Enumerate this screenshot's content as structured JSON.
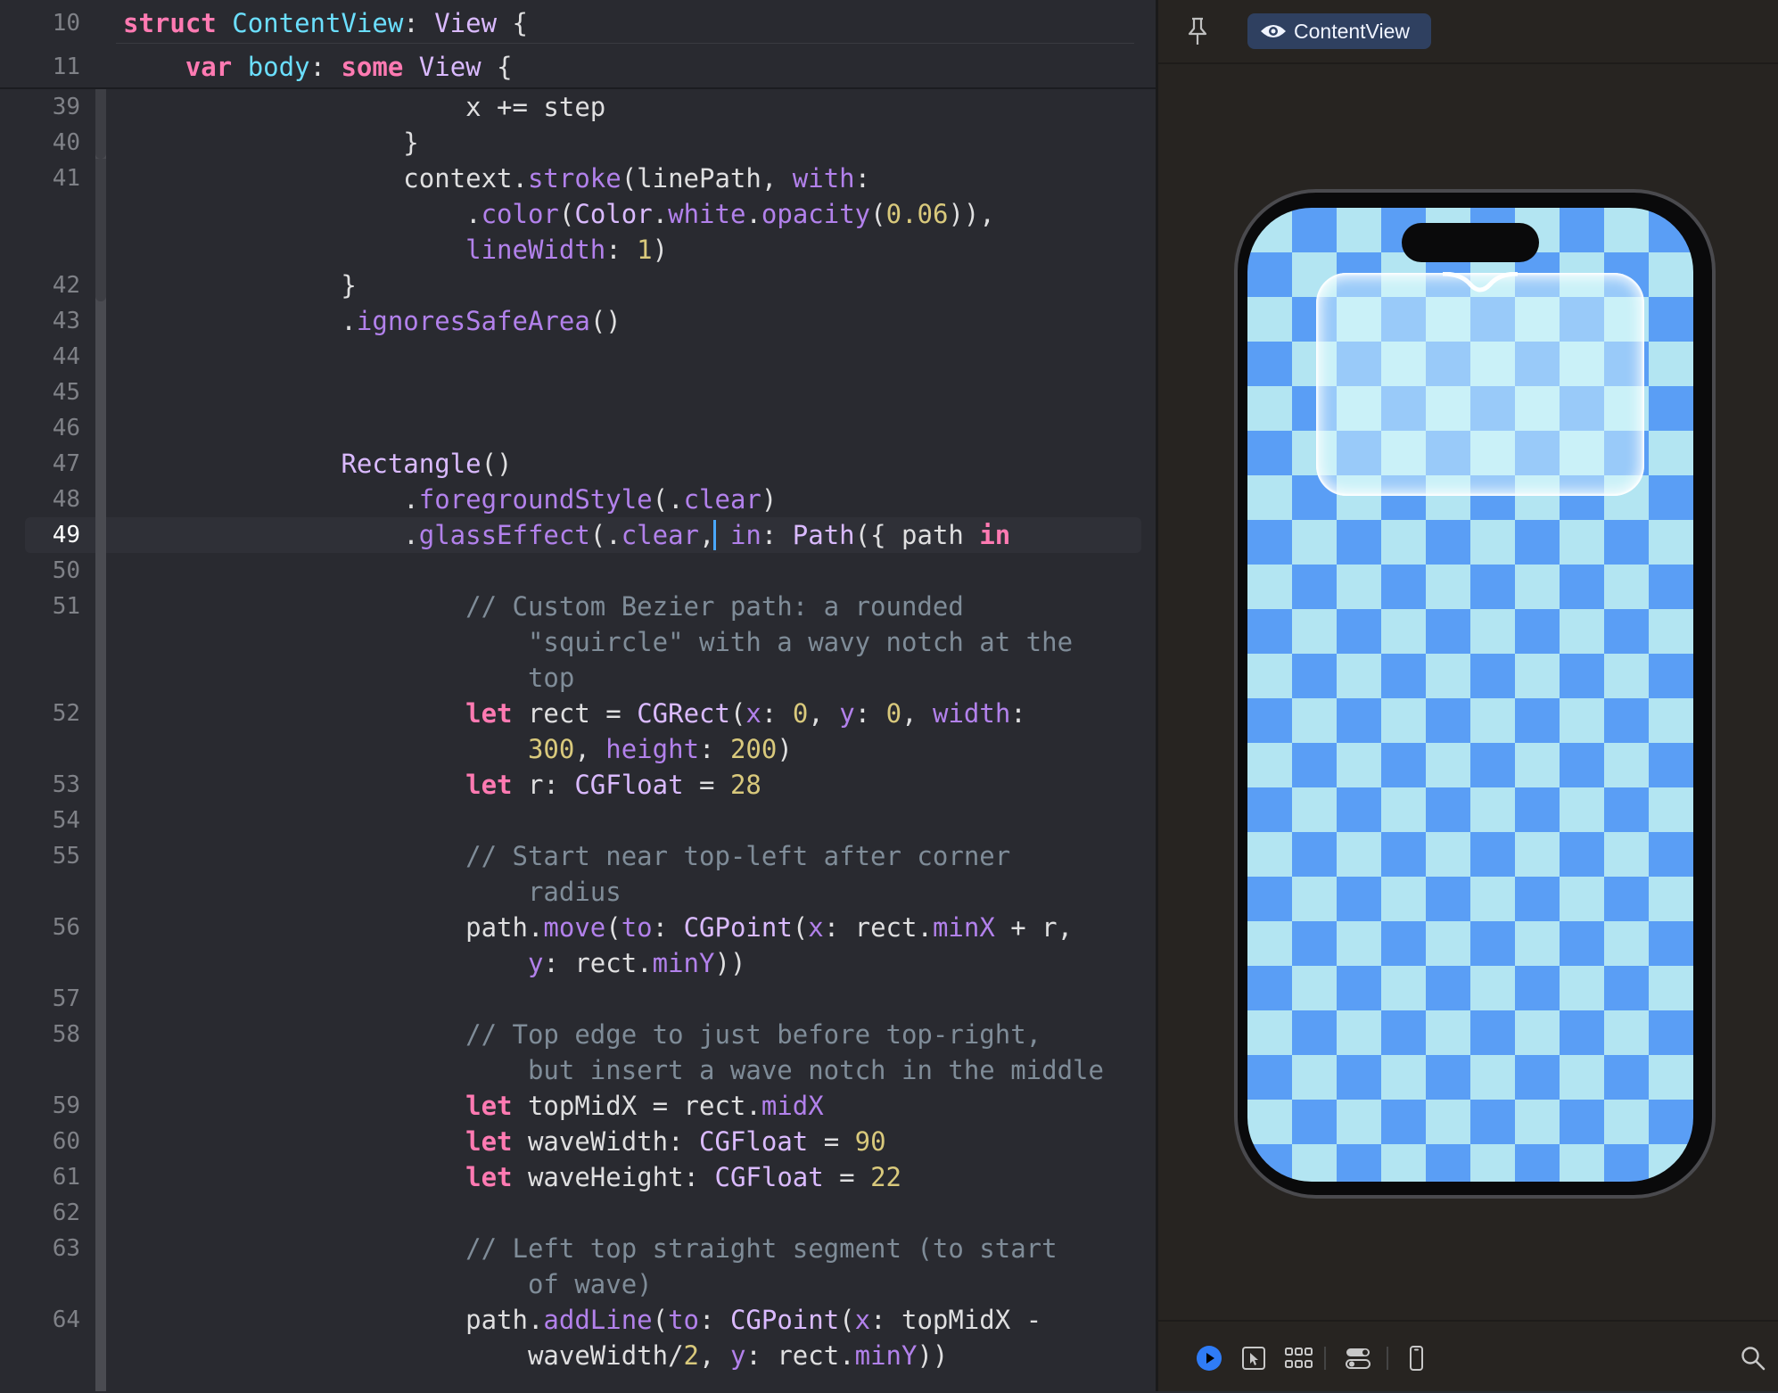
{
  "editor": {
    "sticky": [
      {
        "num": "10",
        "code": "<span class=\"k\">struct</span> <span class=\"ty\">ContentView</span>: <span class=\"t\">View</span> {"
      },
      {
        "num": "11",
        "code": "    <span class=\"k\">var</span> <span class=\"ty\">body</span>: <span class=\"k\">some</span> <span class=\"t\">View</span> {"
      }
    ],
    "lines": [
      {
        "num": "39",
        "code": "                      x += step"
      },
      {
        "num": "40",
        "code": "                  }"
      },
      {
        "num": "41",
        "code": "                  context.<span class=\"m\">stroke</span>(linePath, <span class=\"m\">with</span>:"
      },
      {
        "num": "",
        "code": "                      .<span class=\"m\">color</span>(<span class=\"t\">Color</span>.<span class=\"m\">white</span>.<span class=\"m\">opacity</span>(<span class=\"n\">0.06</span>)),"
      },
      {
        "num": "",
        "code": "                      <span class=\"m\">lineWidth</span>: <span class=\"n\">1</span>)"
      },
      {
        "num": "42",
        "code": "              }"
      },
      {
        "num": "43",
        "code": "              .<span class=\"m\">ignoresSafeArea</span>()"
      },
      {
        "num": "44",
        "code": ""
      },
      {
        "num": "45",
        "code": ""
      },
      {
        "num": "46",
        "code": ""
      },
      {
        "num": "47",
        "code": "              <span class=\"t\">Rectangle</span>()"
      },
      {
        "num": "48",
        "code": "                  .<span class=\"m\">foregroundStyle</span>(.<span class=\"m\">clear</span>)"
      },
      {
        "num": "49",
        "code": "                  .<span class=\"m\">glassEffect</span>(.<span class=\"m\">clear</span>, <span class=\"m\">in</span>: <span class=\"t\">Path</span>({ path <span class=\"k\">in</span>"
      },
      {
        "num": "50",
        "code": ""
      },
      {
        "num": "51",
        "code": "                      <span class=\"c\">// Custom Bezier path: a rounded</span>"
      },
      {
        "num": "",
        "code": "                          <span class=\"c\">\"squircle\" with a wavy notch at the</span>"
      },
      {
        "num": "",
        "code": "                          <span class=\"c\">top</span>"
      },
      {
        "num": "52",
        "code": "                      <span class=\"k\">let</span> rect = <span class=\"t\">CGRect</span>(<span class=\"m\">x</span>: <span class=\"n\">0</span>, <span class=\"m\">y</span>: <span class=\"n\">0</span>, <span class=\"m\">width</span>:"
      },
      {
        "num": "",
        "code": "                          <span class=\"n\">300</span>, <span class=\"m\">height</span>: <span class=\"n\">200</span>)"
      },
      {
        "num": "53",
        "code": "                      <span class=\"k\">let</span> r: <span class=\"t\">CGFloat</span> = <span class=\"n\">28</span>"
      },
      {
        "num": "54",
        "code": ""
      },
      {
        "num": "55",
        "code": "                      <span class=\"c\">// Start near top-left after corner</span>"
      },
      {
        "num": "",
        "code": "                          <span class=\"c\">radius</span>"
      },
      {
        "num": "56",
        "code": "                      path.<span class=\"m\">move</span>(<span class=\"m\">to</span>: <span class=\"t\">CGPoint</span>(<span class=\"m\">x</span>: rect.<span class=\"m\">minX</span> + r,"
      },
      {
        "num": "",
        "code": "                          <span class=\"m\">y</span>: rect.<span class=\"m\">minY</span>))"
      },
      {
        "num": "57",
        "code": ""
      },
      {
        "num": "58",
        "code": "                      <span class=\"c\">// Top edge to just before top-right,</span>"
      },
      {
        "num": "",
        "code": "                          <span class=\"c\">but insert a wave notch in the middle</span>"
      },
      {
        "num": "59",
        "code": "                      <span class=\"k\">let</span> topMidX = rect.<span class=\"m\">midX</span>"
      },
      {
        "num": "60",
        "code": "                      <span class=\"k\">let</span> waveWidth: <span class=\"t\">CGFloat</span> = <span class=\"n\">90</span>"
      },
      {
        "num": "61",
        "code": "                      <span class=\"k\">let</span> waveHeight: <span class=\"t\">CGFloat</span> = <span class=\"n\">22</span>"
      },
      {
        "num": "62",
        "code": ""
      },
      {
        "num": "63",
        "code": "                      <span class=\"c\">// Left top straight segment (to start</span>"
      },
      {
        "num": "",
        "code": "                          <span class=\"c\">of wave)</span>"
      },
      {
        "num": "64",
        "code": "                      path.<span class=\"m\">addLine</span>(<span class=\"m\">to</span>: <span class=\"t\">CGPoint</span>(<span class=\"m\">x</span>: topMidX -"
      },
      {
        "num": "",
        "code": "                          waveWidth/<span class=\"n\">2</span>, <span class=\"m\">y</span>: rect.<span class=\"m\">minY</span>))"
      }
    ],
    "current_line": "49"
  },
  "canvas": {
    "view_tab_label": "ContentView",
    "toolbar_icons": [
      "play-icon",
      "cursor-icon",
      "grid-icon",
      "variants-icon",
      "device-icon",
      "zoom-icon"
    ]
  },
  "colors": {
    "editor_bg": "#292a30",
    "canvas_bg": "#272421",
    "checker_dark": "#5a9ef5",
    "checker_light": "#b3e5f2",
    "keyword": "#ff7ab2",
    "comment": "#7f8c98",
    "number": "#d9c97c",
    "method": "#b281eb",
    "type": "#dabaff",
    "accent": "#2f7cf6"
  }
}
